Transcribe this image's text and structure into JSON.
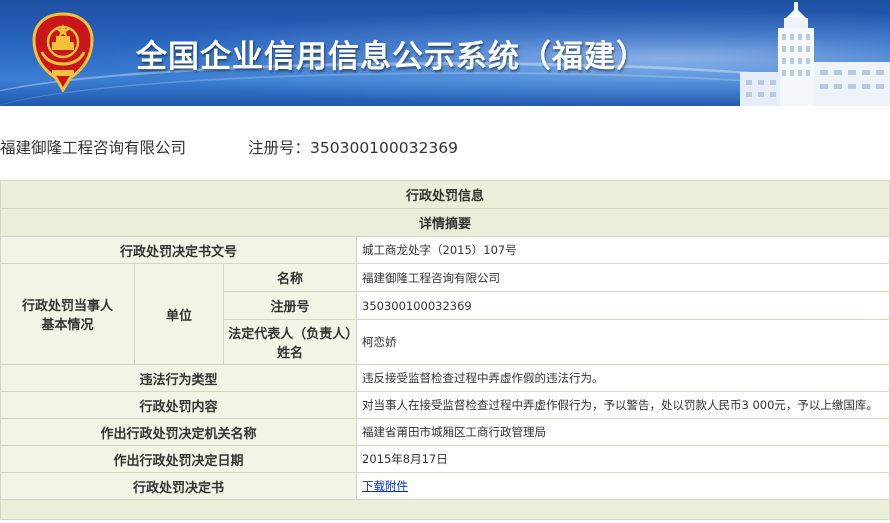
{
  "banner": {
    "title": "全国企业信用信息公示系统（福建）",
    "colors": {
      "sky_top": "#1d4fa2",
      "sky_bottom": "#3b7fd3",
      "emblem_red": "#c8161d",
      "emblem_gold": "#f2c23a"
    }
  },
  "company": {
    "name": "福建御隆工程咨询有限公司",
    "reg_label": "注册号：",
    "reg_no": "350300100032369"
  },
  "table": {
    "title": "行政处罚信息",
    "subtitle": "详情摘要",
    "decision_no_label": "行政处罚决定书文号",
    "decision_no": "城工商龙处字（2015）107号",
    "party_label": "行政处罚当事人基本情况",
    "unit_label": "单位",
    "name_label": "名称",
    "name_value": "福建御隆工程咨询有限公司",
    "reg_label": "注册号",
    "reg_value": "350300100032369",
    "rep_label": "法定代表人（负责人）姓名",
    "rep_value": "柯恋娇",
    "violation_label": "违法行为类型",
    "violation_value": "违反接受监督检查过程中弄虚作假的违法行为。",
    "content_label": "行政处罚内容",
    "content_value": "对当事人在接受监督检查过程中弄虚作假行为，予以警告，处以罚款人民币3 000元，予以上缴国库。",
    "authority_label": "作出行政处罚决定机关名称",
    "authority_value": "福建省莆田市城厢区工商行政管理局",
    "date_label": "作出行政处罚决定日期",
    "date_value": "2015年8月17日",
    "doc_label": "行政处罚决定书",
    "doc_link": "下载附件"
  }
}
